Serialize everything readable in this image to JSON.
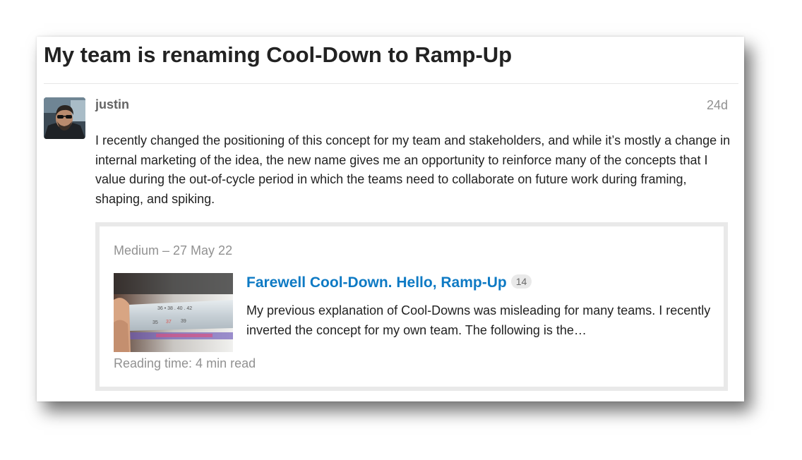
{
  "topic": {
    "title": "My team is renaming Cool-Down to Ramp-Up"
  },
  "post": {
    "avatar_icon": "user-avatar-photo",
    "username": "justin",
    "relative_date": "24d",
    "body": "I recently changed the positioning of this concept for my team and stakeholders, and while it’s mostly a change in internal marketing of the idea, the new name gives me an opportunity to reinforce many of the concepts that I value during the out-of-cycle period in which the teams need to collaborate on future work during framing, shaping, and spiking."
  },
  "onebox": {
    "source": "Medium – 27 May 22",
    "thumbnail_icon": "thermometer-thumbnail",
    "link_title": "Farewell Cool-Down. Hello, Ramp-Up",
    "click_count": "14",
    "excerpt": "My previous explanation of Cool-Downs was misleading for many teams. I recently inverted the concept for my own team. The following is the…",
    "reading_time": "Reading time: 4 min read"
  },
  "colors": {
    "link": "#0e7ac4",
    "text": "#222222",
    "muted": "#919191",
    "border": "#e9e9e9"
  }
}
